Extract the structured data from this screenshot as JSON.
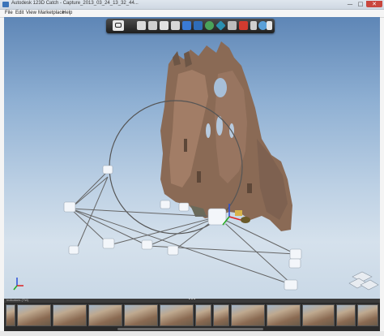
{
  "window": {
    "title": "Autodesk 123D Catch - Capture_2013_03_24_13_32_44...",
    "min_glyph": "—",
    "max_glyph": "□",
    "close_glyph": "✕"
  },
  "menu": {
    "items": [
      "File",
      "Edit",
      "View",
      "Marketplace",
      "Help"
    ]
  },
  "toolbar": {
    "icons": [
      "camera-icon",
      "orbit-icon",
      "pan-icon",
      "zoom-icon",
      "fit-icon",
      "select-icon",
      "camera-view-icon",
      "photo-stack-icon",
      "render-icon",
      "mesh-icon",
      "youtube-icon",
      "measure-icon",
      "share-icon",
      "export-icon"
    ]
  },
  "strip": {
    "label": "Indicators (TW)",
    "dots": "• • •"
  },
  "colors": {
    "toolbar_bg": "#2b2b2b",
    "sky_top": "#5e86b6",
    "sky_bottom": "#d5e1ec",
    "filmstrip_bg": "#2a2a2a"
  }
}
